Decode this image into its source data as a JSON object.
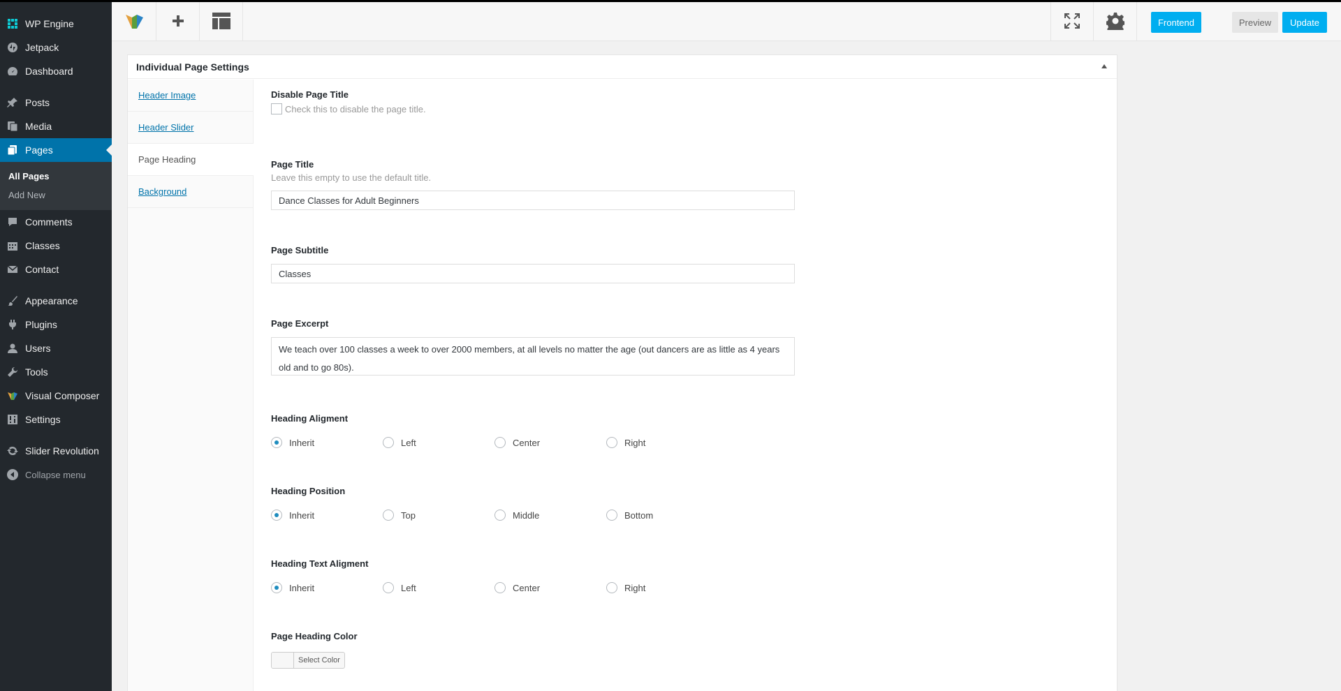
{
  "sidebar": {
    "items": [
      {
        "label": "WP Engine",
        "icon": "grid-icon"
      },
      {
        "label": "Jetpack",
        "icon": "jetpack-icon"
      },
      {
        "label": "Dashboard",
        "icon": "dashboard-icon"
      },
      {
        "label": "Posts",
        "icon": "pin-icon"
      },
      {
        "label": "Media",
        "icon": "media-icon"
      },
      {
        "label": "Pages",
        "icon": "pages-icon"
      },
      {
        "label": "Comments",
        "icon": "comment-icon"
      },
      {
        "label": "Classes",
        "icon": "calendar-icon"
      },
      {
        "label": "Contact",
        "icon": "mail-icon"
      },
      {
        "label": "Appearance",
        "icon": "brush-icon"
      },
      {
        "label": "Plugins",
        "icon": "plug-icon"
      },
      {
        "label": "Users",
        "icon": "user-icon"
      },
      {
        "label": "Tools",
        "icon": "wrench-icon"
      },
      {
        "label": "Visual Composer",
        "icon": "vc-logo-icon"
      },
      {
        "label": "Settings",
        "icon": "settings-icon"
      },
      {
        "label": "Slider Revolution",
        "icon": "refresh-icon"
      }
    ],
    "submenu": [
      "All Pages",
      "Add New"
    ],
    "collapse_label": "Collapse menu"
  },
  "toolbar": {
    "frontend_label": "Frontend",
    "preview_label": "Preview",
    "update_label": "Update"
  },
  "panel": {
    "title": "Individual Page Settings",
    "tabs": [
      "Header Image",
      "Header Slider",
      "Page Heading",
      "Background"
    ],
    "active_tab": "Page Heading"
  },
  "fields": {
    "disable_title": {
      "label": "Disable Page Title",
      "desc": "Check this to disable the page title."
    },
    "page_title": {
      "label": "Page Title",
      "desc": "Leave this empty to use the default title.",
      "value": "Dance Classes for Adult Beginners"
    },
    "page_subtitle": {
      "label": "Page Subtitle",
      "value": "Classes"
    },
    "page_excerpt": {
      "label": "Page Excerpt",
      "value": "We teach over 100 classes a week to over 2000 members, at all levels no matter the age (out dancers are as little as 4 years old and to go 80s)."
    },
    "heading_alignment": {
      "label": "Heading Aligment",
      "options": [
        "Inherit",
        "Left",
        "Center",
        "Right"
      ],
      "selected": "Inherit"
    },
    "heading_position": {
      "label": "Heading Position",
      "options": [
        "Inherit",
        "Top",
        "Middle",
        "Bottom"
      ],
      "selected": "Inherit"
    },
    "heading_text_alignment": {
      "label": "Heading Text Aligment",
      "options": [
        "Inherit",
        "Left",
        "Center",
        "Right"
      ],
      "selected": "Inherit"
    },
    "heading_color": {
      "label": "Page Heading Color",
      "button_label": "Select Color"
    }
  },
  "colors": {
    "sidebar_bg": "#23282d",
    "accent": "#0073aa",
    "button_blue": "#00aef0"
  }
}
